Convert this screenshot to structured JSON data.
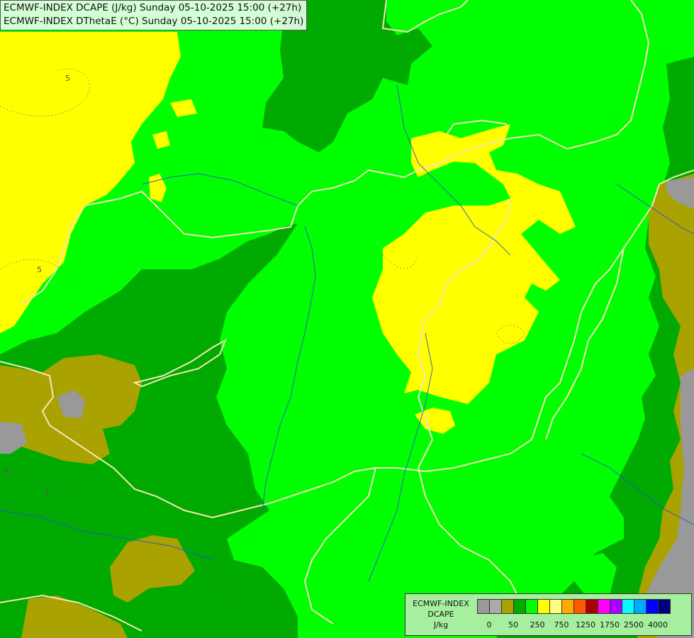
{
  "header": {
    "line1": "ECMWF-INDEX DCAPE (J/kg) Sunday 05-10-2025 15:00 (+27h)",
    "line2": "ECMWF-INDEX DThetaE (°C) Sunday 05-10-2025 15:00 (+27h)"
  },
  "map": {
    "background_color": "#00ff00",
    "field_colors": {
      "gray": "#999999",
      "olive": "#aaa200",
      "dark_green": "#00aa00",
      "bright_green": "#00ff00",
      "yellow": "#ffff00"
    },
    "border_color": "#f5e6b8",
    "river_color": "#2a4fd8",
    "contour_labels": [
      "5",
      "5",
      "5",
      "5"
    ]
  },
  "legend": {
    "title_line1": "ECMWF-INDEX",
    "title_line2": "DCAPE",
    "unit": "J/kg",
    "colors": [
      "#999999",
      "#aaaaaa",
      "#aaa200",
      "#00aa00",
      "#00ff00",
      "#ffff00",
      "#ffff80",
      "#ffaa00",
      "#ff5a00",
      "#aa0000",
      "#ff00ff",
      "#aa00ff",
      "#00ffff",
      "#00aaff",
      "#0000ff",
      "#000080"
    ],
    "tick_labels": [
      "0",
      "50",
      "250",
      "750",
      "1250",
      "1750",
      "2500",
      "4000"
    ]
  }
}
